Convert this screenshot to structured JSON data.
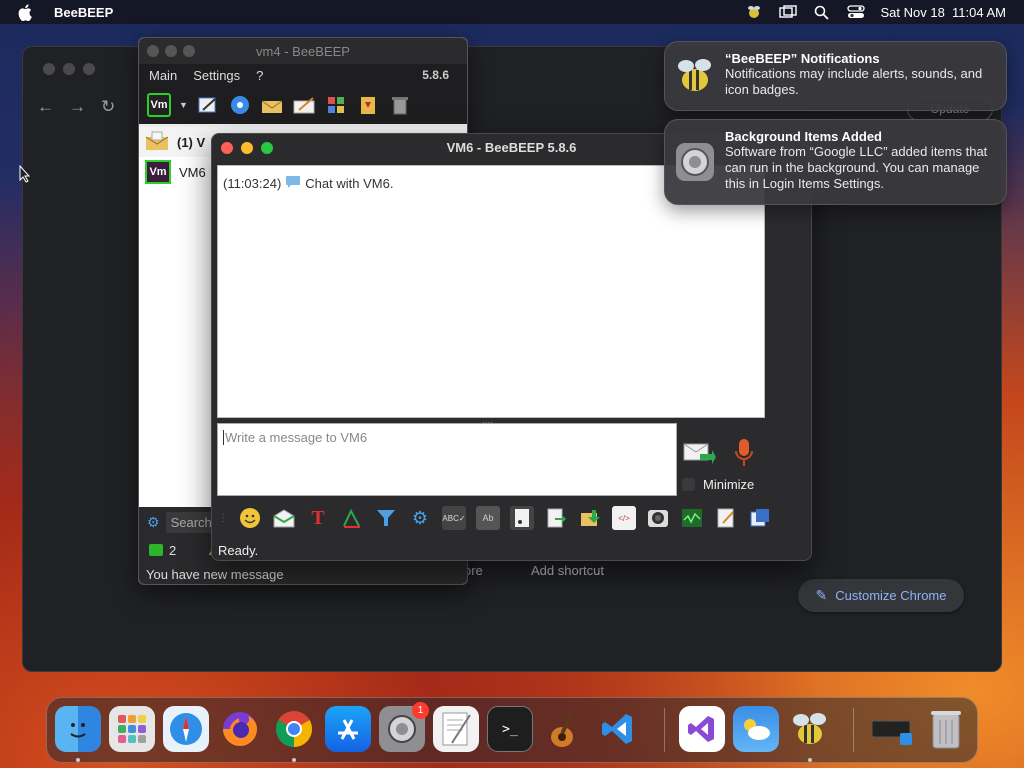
{
  "menubar": {
    "app_name": "BeeBEEP",
    "datetime": "Sat Nov 18  11:04 AM"
  },
  "chrome": {
    "more_label": "ore",
    "add_shortcut": "Add shortcut",
    "customize": "Customize Chrome",
    "update_label": "Update"
  },
  "vm4": {
    "title": "vm4 - BeeBEEP",
    "menu": [
      "Main",
      "Settings",
      "?"
    ],
    "version": "5.8.6",
    "users": [
      {
        "label": "(1) V"
      },
      {
        "label": "VM6"
      }
    ],
    "search_placeholder": "Search",
    "online_count": "2",
    "notice": "You have new message"
  },
  "vm6": {
    "title": "VM6 - BeeBEEP 5.8.6",
    "chat_time": "(11:03:24)",
    "chat_text": "Chat with VM6.",
    "input_placeholder": "Write a message to VM6",
    "minimize_label": "Minimize",
    "status": "Ready."
  },
  "notifications": [
    {
      "title": "“BeeBEEP” Notifications",
      "body": "Notifications may include alerts, sounds, and icon badges."
    },
    {
      "title": "Background Items Added",
      "body": "Software from “Google LLC” added items that can run in the background. You can manage this in Login Items Settings."
    }
  ],
  "dock": {
    "settings_badge": "1",
    "apps": [
      "finder-icon",
      "launchpad-icon",
      "safari-icon",
      "firefox-icon",
      "chrome-icon",
      "app-store-icon",
      "system-settings-icon",
      "textedit-icon",
      "terminal-icon",
      "garageband-icon",
      "vscode-icon",
      "visual-studio-icon",
      "weather-icon",
      "beebeep-icon",
      "keyboard-viewer-icon",
      "trash-icon"
    ]
  }
}
